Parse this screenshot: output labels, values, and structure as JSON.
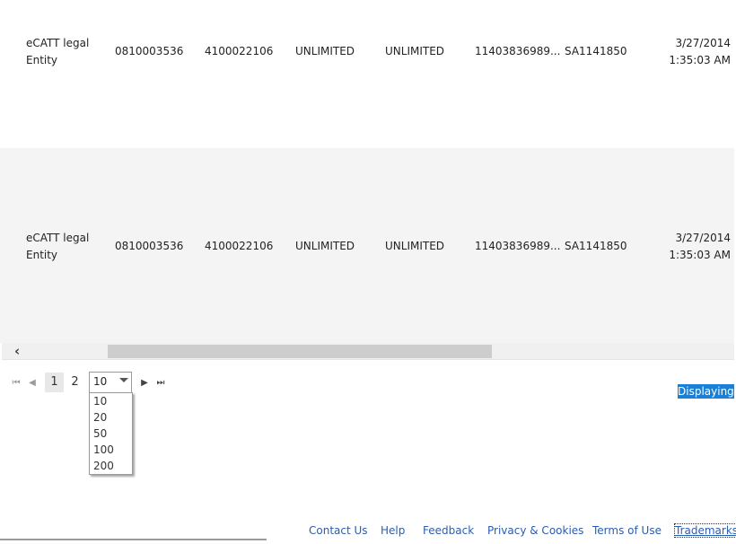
{
  "rows": [
    {
      "entity_line1": "eCATT legal",
      "entity_line2": "Entity",
      "col_a": "0810003536",
      "col_b": "4100022106",
      "col_c": "UNLIMITED",
      "col_d": "UNLIMITED",
      "col_e": "11403836989...",
      "col_f": "SA1141850",
      "date": "3/27/2014",
      "time": "1:35:03 AM"
    },
    {
      "entity_line1": "eCATT legal",
      "entity_line2": "Entity",
      "col_a": "0810003536",
      "col_b": "4100022106",
      "col_c": "UNLIMITED",
      "col_d": "UNLIMITED",
      "col_e": "11403836989...",
      "col_f": "SA1141850",
      "date": "3/27/2014",
      "time": "1:35:03 AM"
    }
  ],
  "scrollbar": {
    "left_icon": "chevron-left-icon"
  },
  "pager": {
    "first_icon": "first-page-icon",
    "prev_icon": "previous-page-icon",
    "next_icon": "next-page-icon",
    "last_icon": "last-page-icon",
    "pages": [
      "1",
      "2"
    ],
    "current_page": "1",
    "page_size": "10",
    "page_size_options": [
      "10",
      "20",
      "50",
      "100",
      "200"
    ],
    "status_text": "Displaying it"
  },
  "footer": {
    "links": [
      "Contact Us",
      "Help",
      "Feedback",
      "Privacy & Cookies",
      "Terms of Use",
      "Trademarks"
    ]
  },
  "colors": {
    "selection_blue": "#1a7fd6",
    "link_blue": "#2a5db0",
    "alt_row": "#f4f4f4"
  }
}
